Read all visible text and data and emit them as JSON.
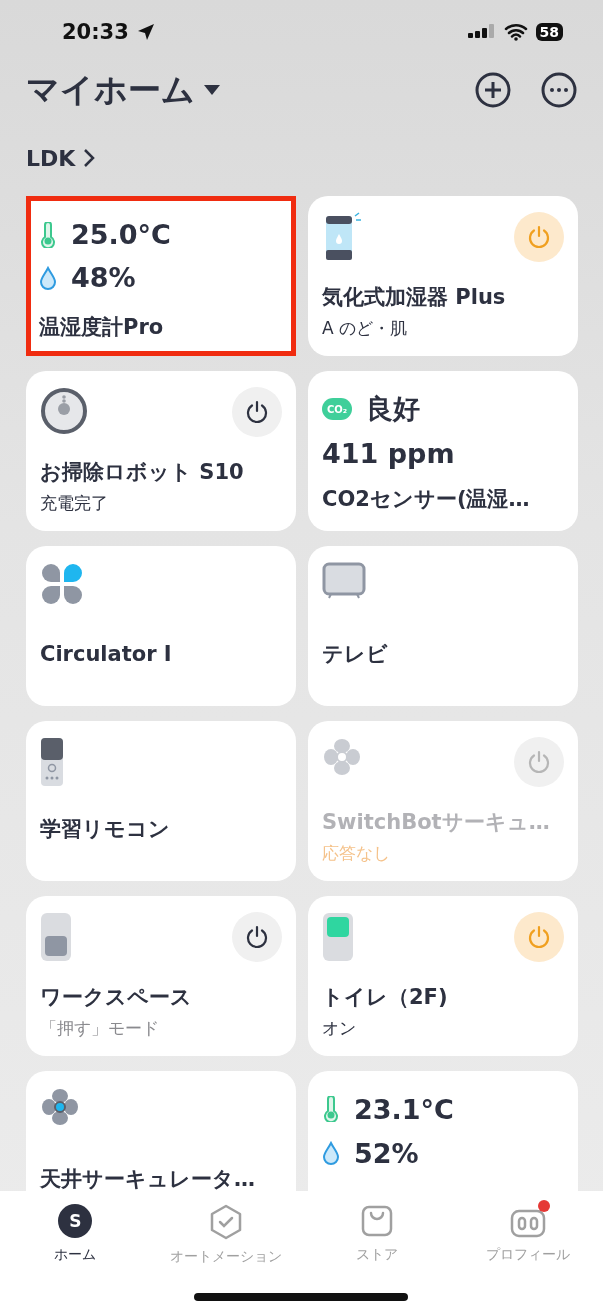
{
  "status_bar": {
    "time": "20:33",
    "battery": "58"
  },
  "header": {
    "title": "マイホーム",
    "room": "LDK"
  },
  "cards": [
    {
      "kind": "sensor",
      "highlighted": true,
      "temperature": "25.0°C",
      "humidity": "48%",
      "name": "温湿度計Pro"
    },
    {
      "kind": "humidifier",
      "on": true,
      "offline": false,
      "name": "気化式加湿器 Plus",
      "status": "A のど・肌",
      "status_muted": false
    },
    {
      "kind": "robot",
      "on": false,
      "offline": false,
      "name": "お掃除ロボット S10",
      "status": "充電完了",
      "status_muted": false
    },
    {
      "kind": "co2",
      "air": "良好",
      "value": "411 ppm",
      "name": "CO2センサー(温湿…",
      "icon_label": "CO₂"
    },
    {
      "kind": "circulator",
      "name": "Circulator I"
    },
    {
      "kind": "tv",
      "name": "テレビ"
    },
    {
      "kind": "remote",
      "name": "学習リモコン"
    },
    {
      "kind": "fan",
      "on": false,
      "offline": true,
      "name": "SwitchBotサーキュ…",
      "status": "応答なし",
      "status_muted": false
    },
    {
      "kind": "switch",
      "on": false,
      "offline": false,
      "name": "ワークスペース",
      "status": "「押す」モード",
      "status_muted": true
    },
    {
      "kind": "switch",
      "on": true,
      "offline": false,
      "name": "トイレ（2F)",
      "status": "オン",
      "status_muted": false
    },
    {
      "kind": "ceiling_fan",
      "name": "天井サーキュレータ…"
    },
    {
      "kind": "sensor",
      "highlighted": false,
      "temperature": "23.1°C",
      "humidity": "52%"
    }
  ],
  "nav": [
    {
      "kind": "avatar",
      "label": "ホーム",
      "icon_text": "S",
      "selected": true
    },
    {
      "kind": "automation",
      "label": "オートメーション",
      "selected": false
    },
    {
      "kind": "store",
      "label": "ストア",
      "selected": false
    },
    {
      "kind": "profile",
      "label": "プロフィール",
      "selected": false,
      "badge": true
    }
  ]
}
